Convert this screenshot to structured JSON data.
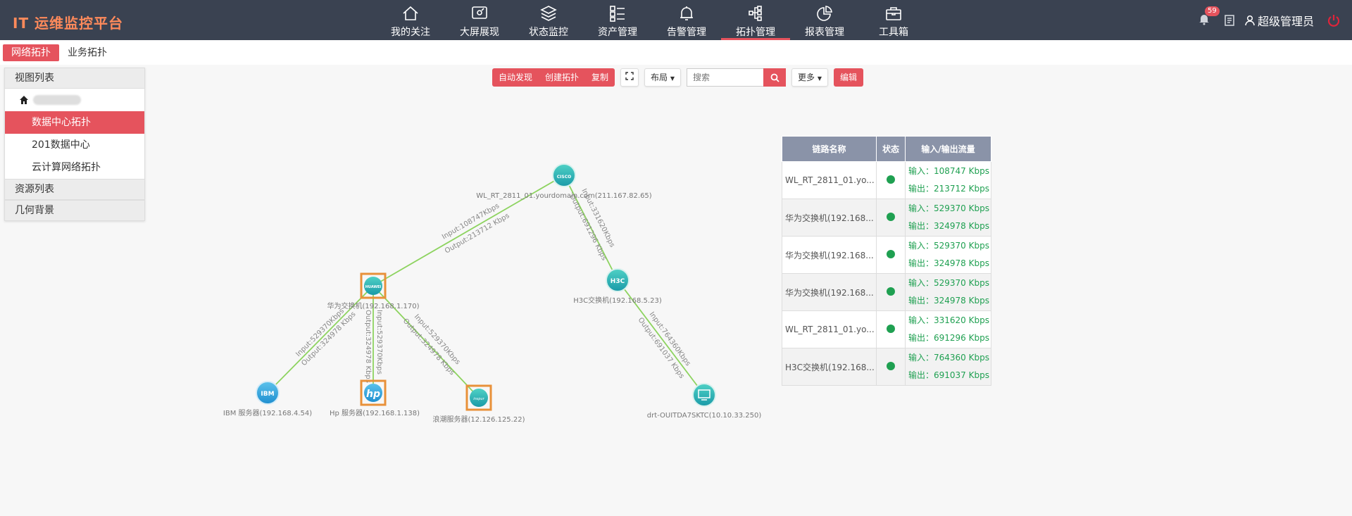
{
  "app": {
    "title": "IT 运维监控平台"
  },
  "nav": {
    "items": [
      {
        "label": "我的关注",
        "icon": "home-icon"
      },
      {
        "label": "大屏展现",
        "icon": "screen-icon"
      },
      {
        "label": "状态监控",
        "icon": "layers-icon"
      },
      {
        "label": "资产管理",
        "icon": "list-icon"
      },
      {
        "label": "告警管理",
        "icon": "bell-icon"
      },
      {
        "label": "拓扑管理",
        "icon": "topology-icon"
      },
      {
        "label": "报表管理",
        "icon": "pie-chart-icon"
      },
      {
        "label": "工具箱",
        "icon": "toolbox-icon"
      }
    ],
    "active": "拓扑管理"
  },
  "header": {
    "alert_count": "59",
    "user_name": "超级管理员"
  },
  "subtabs": {
    "network": "网络拓扑",
    "business": "业务拓扑"
  },
  "left_panel": {
    "view_list_title": "视图列表",
    "views": [
      "数据中心拓扑",
      "201数据中心",
      "云计算网络拓扑"
    ],
    "active_view": "数据中心拓扑",
    "resource_list_title": "资源列表",
    "geometry_title": "几何背景"
  },
  "toolbar": {
    "auto_discover": "自动发现",
    "create_topo": "创建拓扑",
    "copy": "复制",
    "layout": "布局",
    "search_placeholder": "搜索",
    "more": "更多",
    "edit": "编辑"
  },
  "topology": {
    "nodes": {
      "router": {
        "label": "WL_RT_2811_01.yourdomain.com(211.167.82.65)",
        "logo": "CISCO"
      },
      "huawei": {
        "label": "华为交换机(192.168.1.170)",
        "logo": "HUAWEI"
      },
      "h3c": {
        "label": "H3C交换机(192.168.5.23)",
        "logo": "H3C"
      },
      "ibm": {
        "label": "IBM 服务器(192.168.4.54)",
        "logo": "IBM"
      },
      "hp": {
        "label": "Hp 服务器(192.168.1.138)",
        "logo": "hp"
      },
      "inspur": {
        "label": "浪潮服务器(12.126.125.22)",
        "logo": "inspur"
      },
      "drt": {
        "label": "drt-OUITDA7SKTC(10.10.33.250)",
        "logo": "PC"
      }
    },
    "links": {
      "router_huawei": {
        "in": "Input:108747Kbps",
        "out": "Output:213712 Kbps"
      },
      "router_h3c": {
        "in": "Input:331620Kbps",
        "out": "Output:691296 Kbps"
      },
      "huawei_ibm": {
        "in": "Input:529370Kbps",
        "out": "Output:324978 Kbps"
      },
      "huawei_hp": {
        "in": "Input:529370Kbps",
        "out": "Output:324978 Kbps"
      },
      "huawei_inspur": {
        "in": "Input:529370Kbps",
        "out": "Output:324978 Kbps"
      },
      "h3c_drt": {
        "in": "Input:764360Kbps",
        "out": "Output:691037 Kbps"
      }
    }
  },
  "link_table": {
    "headers": [
      "链路名称",
      "状态",
      "输入/输出流量"
    ],
    "rows": [
      {
        "name": "WL_RT_2811_01.yo...",
        "in": "输入：108747 Kbps",
        "out": "输出：213712 Kbps"
      },
      {
        "name": "华为交换机(192.168...",
        "in": "输入：529370 Kbps",
        "out": "输出：324978 Kbps"
      },
      {
        "name": "华为交换机(192.168...",
        "in": "输入：529370 Kbps",
        "out": "输出：324978 Kbps"
      },
      {
        "name": "华为交换机(192.168...",
        "in": "输入：529370 Kbps",
        "out": "输出：324978 Kbps"
      },
      {
        "name": "WL_RT_2811_01.yo...",
        "in": "输入：331620 Kbps",
        "out": "输出：691296 Kbps"
      },
      {
        "name": "H3C交换机(192.168...",
        "in": "输入：764360 Kbps",
        "out": "输出：691037 Kbps"
      }
    ],
    "status_color": "#1fa051"
  },
  "colors": {
    "accent": "#e5535d",
    "header_bg": "#3a4251",
    "logo": "#ff8a5b",
    "link_line": "#8dd35f",
    "node_teal": "#2bbfb0"
  }
}
